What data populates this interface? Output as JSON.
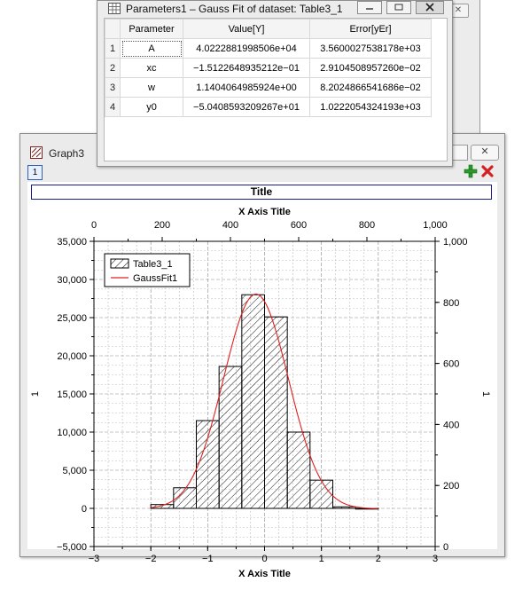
{
  "background_window": {
    "close_glyph": "✕"
  },
  "graph_window": {
    "title": "Graph3",
    "icon": "graph-icon",
    "close_glyph": "✕",
    "layer_label": "1",
    "plus_icon": "add-layer-icon",
    "remove_icon": "remove-layer-icon",
    "plot_title": "Title"
  },
  "param_window": {
    "title": "Parameters1 – Gauss Fit of dataset: Table3_1",
    "headers": [
      "Parameter",
      "Value[Y]",
      "Error[yEr]"
    ],
    "rows": [
      {
        "index": "1",
        "name": "A",
        "value": "4.0222881998506e+04",
        "error": "3.5600027538178e+03"
      },
      {
        "index": "2",
        "name": "xc",
        "value": "−1.5122648935212e−01",
        "error": "2.9104508957260e−02"
      },
      {
        "index": "3",
        "name": "w",
        "value": "1.1404064985924e+00",
        "error": "8.2024866541686e−02"
      },
      {
        "index": "4",
        "name": "y0",
        "value": "−5.0408593209267e+01",
        "error": "1.0222054324193e+03"
      }
    ]
  },
  "chart_data": {
    "type": "bar",
    "title": "Title",
    "xlabel": "X Axis Title",
    "top_xlabel": "X Axis Title",
    "ylabel": "1",
    "right_ylabel": "1",
    "xlim": [
      -3,
      3
    ],
    "ylim": [
      -5000,
      35000
    ],
    "top_xlim": [
      0,
      1000
    ],
    "right_ylim": [
      0,
      1000
    ],
    "x_ticks": [
      "−3",
      "−2",
      "−1",
      "0",
      "1",
      "2",
      "3"
    ],
    "y_ticks": [
      "−5,000",
      "0",
      "5,000",
      "10,000",
      "15,000",
      "20,000",
      "25,000",
      "30,000",
      "35,000"
    ],
    "top_ticks": [
      "0",
      "200",
      "400",
      "600",
      "800",
      "1,000"
    ],
    "right_ticks": [
      "0",
      "200",
      "400",
      "600",
      "800",
      "1,000"
    ],
    "grid": true,
    "legend": "top-left",
    "series": [
      {
        "name": "Table3_1",
        "kind": "histogram",
        "bin_edges": [
          -2.0,
          -1.6,
          -1.2,
          -0.8,
          -0.4,
          0.0,
          0.4,
          0.8,
          1.2,
          1.6,
          2.0
        ],
        "values": [
          500,
          2700,
          11500,
          18600,
          28000,
          25100,
          10000,
          3700,
          200,
          0
        ]
      },
      {
        "name": "GaussFit1",
        "kind": "fit",
        "color": "#e02020",
        "A": 40222.881998506,
        "xc": -0.15122648935212,
        "w": 1.1404064985924,
        "y0": -50.408593209267,
        "x_range": [
          -2.0,
          2.0
        ]
      }
    ]
  }
}
